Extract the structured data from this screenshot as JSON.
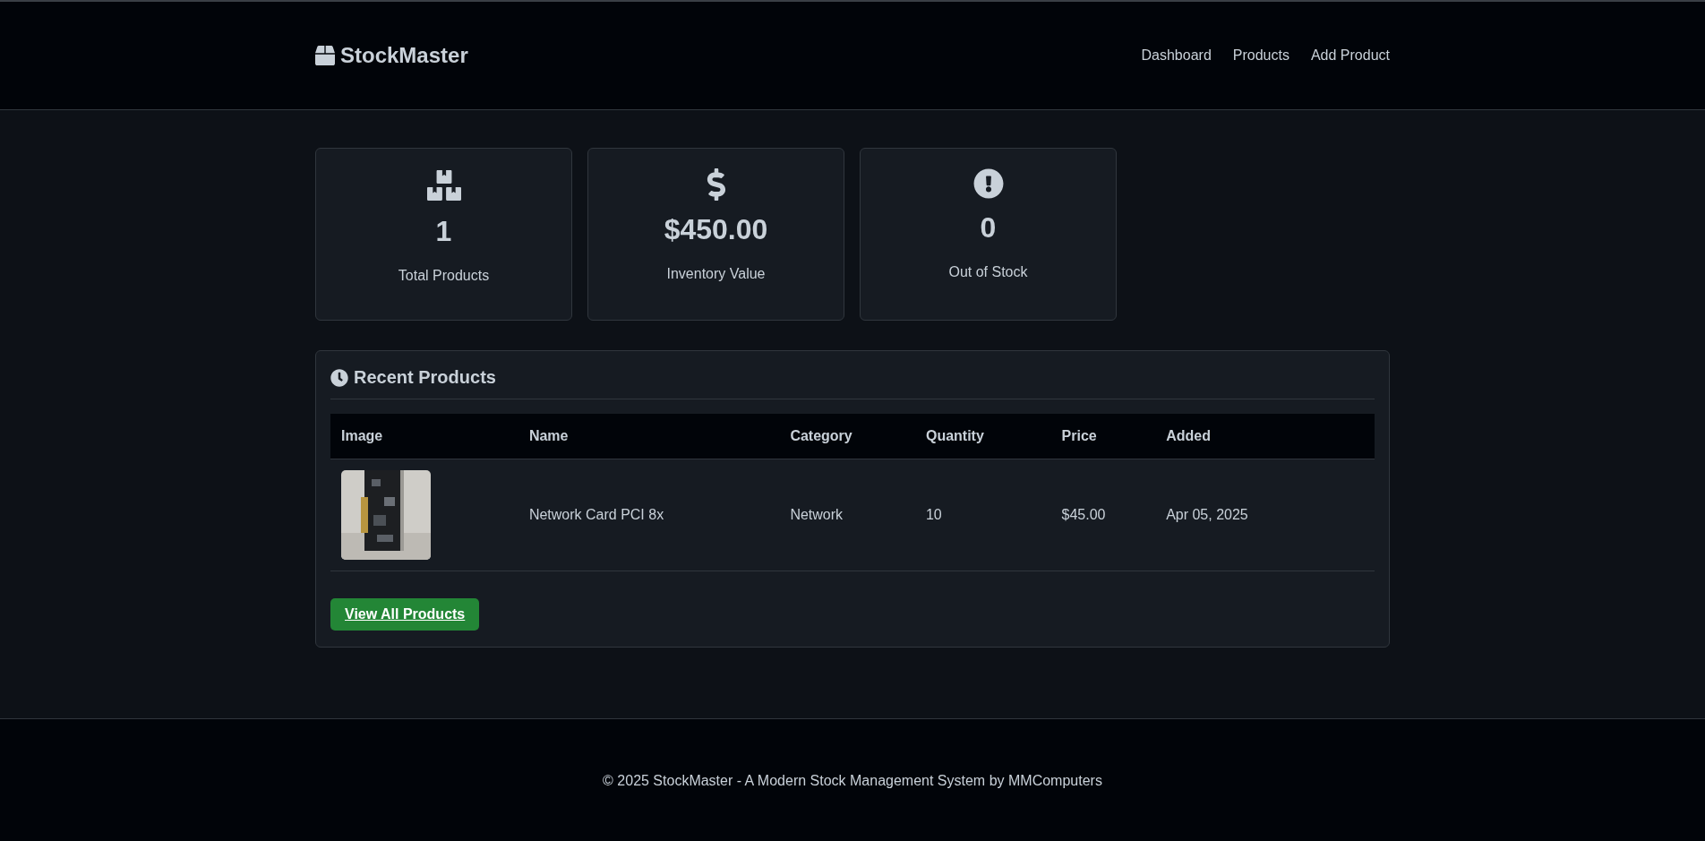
{
  "brand": "StockMaster",
  "nav": [
    {
      "label": "Dashboard"
    },
    {
      "label": "Products"
    },
    {
      "label": "Add Product"
    }
  ],
  "stats": [
    {
      "kind": "boxes",
      "value": "1",
      "label": "Total Products"
    },
    {
      "kind": "dollar",
      "value": "$450.00",
      "label": "Inventory Value"
    },
    {
      "kind": "alert",
      "value": "0",
      "label": "Out of Stock"
    }
  ],
  "recent": {
    "title": "Recent Products",
    "table": {
      "columns": [
        "Image",
        "Name",
        "Category",
        "Quantity",
        "Price",
        "Added"
      ],
      "rows": [
        {
          "name": "Network Card PCI 8x",
          "category": "Network",
          "quantity": "10",
          "price": "$45.00",
          "added": "Apr 05, 2025"
        }
      ]
    },
    "button": "View All Products"
  },
  "footer": "© 2025 StockMaster - A Modern Stock Management System by MMComputers"
}
